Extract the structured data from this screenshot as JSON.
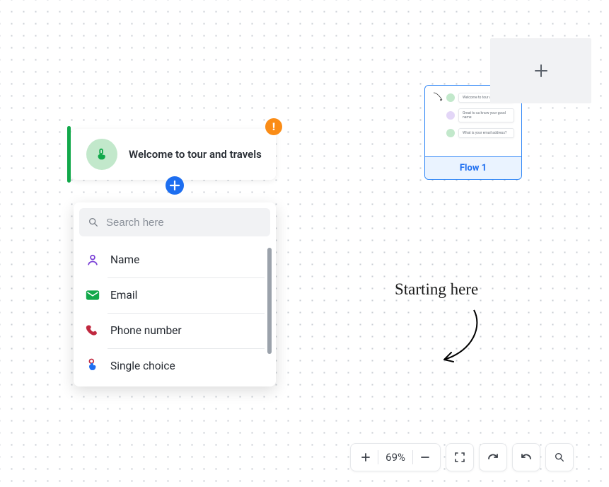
{
  "welcome": {
    "title": "Welcome to tour and travels"
  },
  "dropdown": {
    "search_placeholder": "Search here",
    "items": [
      {
        "label": "Name",
        "icon": "person-icon",
        "color": "#7b42d6"
      },
      {
        "label": "Email",
        "icon": "mail-icon",
        "color": "#11a84a"
      },
      {
        "label": "Phone number",
        "icon": "phone-icon",
        "color": "#c0283f"
      },
      {
        "label": "Single choice",
        "icon": "tap-icon",
        "color": "#1d6ef0"
      }
    ]
  },
  "flow": {
    "label": "Flow 1",
    "mini_cards": [
      "Welcome to tour and travels",
      "Great to us know your good name",
      "What is your email address?"
    ]
  },
  "annotation": {
    "text": "Starting here"
  },
  "toolbar": {
    "zoom": "69%"
  }
}
